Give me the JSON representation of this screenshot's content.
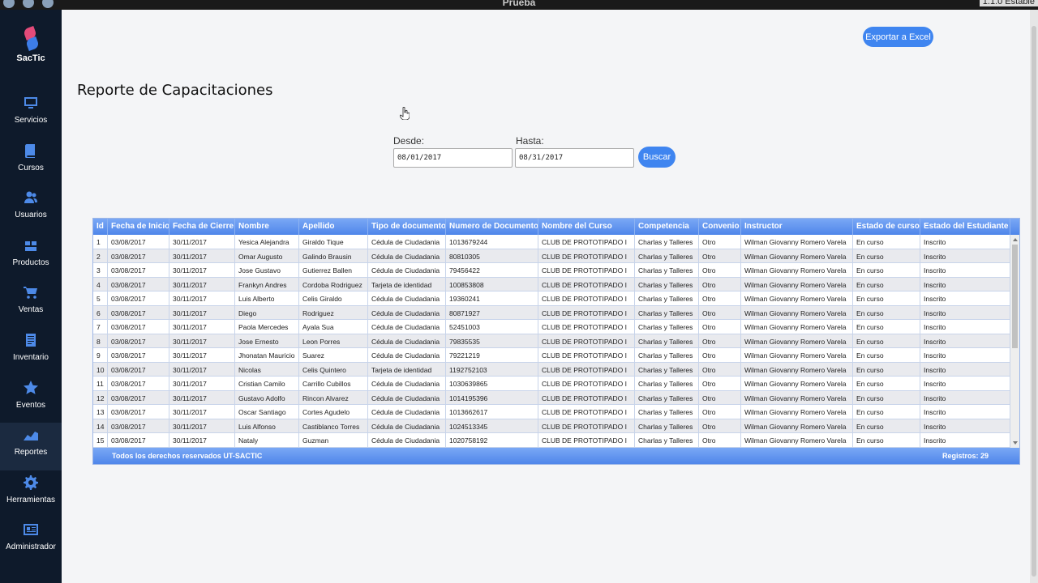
{
  "window": {
    "title": "Prueba",
    "version": "1.1.0 Estable"
  },
  "brand": {
    "name": "SacTic"
  },
  "nav": [
    {
      "label": "Servicios",
      "icon": "monitor-icon"
    },
    {
      "label": "Cursos",
      "icon": "book-icon"
    },
    {
      "label": "Usuarios",
      "icon": "users-icon"
    },
    {
      "label": "Productos",
      "icon": "box-icon"
    },
    {
      "label": "Ventas",
      "icon": "cart-icon"
    },
    {
      "label": "Inventario",
      "icon": "list-icon"
    },
    {
      "label": "Eventos",
      "icon": "star-icon"
    },
    {
      "label": "Reportes",
      "icon": "chart-icon",
      "active": true
    },
    {
      "label": "Herramientas",
      "icon": "gear-icon"
    },
    {
      "label": "Administrador",
      "icon": "id-card-icon"
    }
  ],
  "page": {
    "title": "Reporte de Capacitaciones",
    "export_label": "Exportar a Excel",
    "from_label": "Desde:",
    "from_value": "08/01/2017",
    "to_label": "Hasta:",
    "to_value": "08/31/2017",
    "search_label": "Buscar"
  },
  "table": {
    "columns": [
      "Id",
      "Fecha de Inicio",
      "Fecha de Cierre",
      "Nombre",
      "Apellido",
      "Tipo de documento",
      "Numero de Documento",
      "Nombre del Curso",
      "Competencia",
      "Convenio",
      "Instructor",
      "Estado de curso",
      "Estado del Estudiante"
    ],
    "rows": [
      [
        "1",
        "03/08/2017",
        "30/11/2017",
        "Yesica Alejandra",
        "Giraldo Tique",
        "Cédula de Ciudadania",
        "1013679244",
        "CLUB DE PROTOTIPADO I",
        "Charlas y Talleres",
        "Otro",
        "Wilman Giovanny Romero Varela",
        "En curso",
        "Inscrito"
      ],
      [
        "2",
        "03/08/2017",
        "30/11/2017",
        "Omar Augusto",
        "Galindo Brausin",
        "Cédula de Ciudadania",
        "80810305",
        "CLUB DE PROTOTIPADO I",
        "Charlas y Talleres",
        "Otro",
        "Wilman Giovanny Romero Varela",
        "En curso",
        "Inscrito"
      ],
      [
        "3",
        "03/08/2017",
        "30/11/2017",
        "Jose Gustavo",
        "Gutierrez Ballen",
        "Cédula de Ciudadania",
        "79456422",
        "CLUB DE PROTOTIPADO I",
        "Charlas y Talleres",
        "Otro",
        "Wilman Giovanny Romero Varela",
        "En curso",
        "Inscrito"
      ],
      [
        "4",
        "03/08/2017",
        "30/11/2017",
        "Frankyn Andres",
        "Cordoba Rodriguez",
        "Tarjeta de identidad",
        "100853808",
        "CLUB DE PROTOTIPADO I",
        "Charlas y Talleres",
        "Otro",
        "Wilman Giovanny Romero Varela",
        "En curso",
        "Inscrito"
      ],
      [
        "5",
        "03/08/2017",
        "30/11/2017",
        "Luis Alberto",
        "Celis Giraldo",
        "Cédula de Ciudadania",
        "19360241",
        "CLUB DE PROTOTIPADO I",
        "Charlas y Talleres",
        "Otro",
        "Wilman Giovanny Romero Varela",
        "En curso",
        "Inscrito"
      ],
      [
        "6",
        "03/08/2017",
        "30/11/2017",
        "Diego",
        "Rodriguez",
        "Cédula de Ciudadania",
        "80871927",
        "CLUB DE PROTOTIPADO I",
        "Charlas y Talleres",
        "Otro",
        "Wilman Giovanny Romero Varela",
        "En curso",
        "Inscrito"
      ],
      [
        "7",
        "03/08/2017",
        "30/11/2017",
        "Paola Mercedes",
        "Ayala Sua",
        "Cédula de Ciudadania",
        "52451003",
        "CLUB DE PROTOTIPADO I",
        "Charlas y Talleres",
        "Otro",
        "Wilman Giovanny Romero Varela",
        "En curso",
        "Inscrito"
      ],
      [
        "8",
        "03/08/2017",
        "30/11/2017",
        "Jose Ernesto",
        "Leon Porres",
        "Cédula de Ciudadania",
        "79835535",
        "CLUB DE PROTOTIPADO I",
        "Charlas y Talleres",
        "Otro",
        "Wilman Giovanny Romero Varela",
        "En curso",
        "Inscrito"
      ],
      [
        "9",
        "03/08/2017",
        "30/11/2017",
        "Jhonatan Mauricio",
        "Suarez",
        "Cédula de Ciudadania",
        "79221219",
        "CLUB DE PROTOTIPADO I",
        "Charlas y Talleres",
        "Otro",
        "Wilman Giovanny Romero Varela",
        "En curso",
        "Inscrito"
      ],
      [
        "10",
        "03/08/2017",
        "30/11/2017",
        "Nicolas",
        "Celis Quintero",
        "Tarjeta de identidad",
        "1192752103",
        "CLUB DE PROTOTIPADO I",
        "Charlas y Talleres",
        "Otro",
        "Wilman Giovanny Romero Varela",
        "En curso",
        "Inscrito"
      ],
      [
        "11",
        "03/08/2017",
        "30/11/2017",
        "Cristian Camilo",
        "Carrillo Cubillos",
        "Cédula de Ciudadania",
        "1030639865",
        "CLUB DE PROTOTIPADO I",
        "Charlas y Talleres",
        "Otro",
        "Wilman Giovanny Romero Varela",
        "En curso",
        "Inscrito"
      ],
      [
        "12",
        "03/08/2017",
        "30/11/2017",
        "Gustavo Adolfo",
        "Rincon Alvarez",
        "Cédula de Ciudadania",
        "1014195396",
        "CLUB DE PROTOTIPADO I",
        "Charlas y Talleres",
        "Otro",
        "Wilman Giovanny Romero Varela",
        "En curso",
        "Inscrito"
      ],
      [
        "13",
        "03/08/2017",
        "30/11/2017",
        "Oscar Santiago",
        "Cortes Agudelo",
        "Cédula de Ciudadania",
        "1013662617",
        "CLUB DE PROTOTIPADO I",
        "Charlas y Talleres",
        "Otro",
        "Wilman Giovanny Romero Varela",
        "En curso",
        "Inscrito"
      ],
      [
        "14",
        "03/08/2017",
        "30/11/2017",
        "Luis Alfonso",
        "Castiblanco Torres",
        "Cédula de Ciudadania",
        "1024513345",
        "CLUB DE PROTOTIPADO I",
        "Charlas y Talleres",
        "Otro",
        "Wilman Giovanny Romero Varela",
        "En curso",
        "Inscrito"
      ],
      [
        "15",
        "03/08/2017",
        "30/11/2017",
        "Nataly",
        "Guzman",
        "Cédula de Ciudadania",
        "1020758192",
        "CLUB DE PROTOTIPADO I",
        "Charlas y Talleres",
        "Otro",
        "Wilman Giovanny Romero Varela",
        "En curso",
        "Inscrito"
      ]
    ],
    "footer_rights": "Todos los derechos reservados UT-SACTIC",
    "footer_count": "Registros:   29"
  },
  "colors": {
    "accent": "#3f85f0",
    "sidebar": "#0e1a2b",
    "header": "#5a8fee"
  }
}
